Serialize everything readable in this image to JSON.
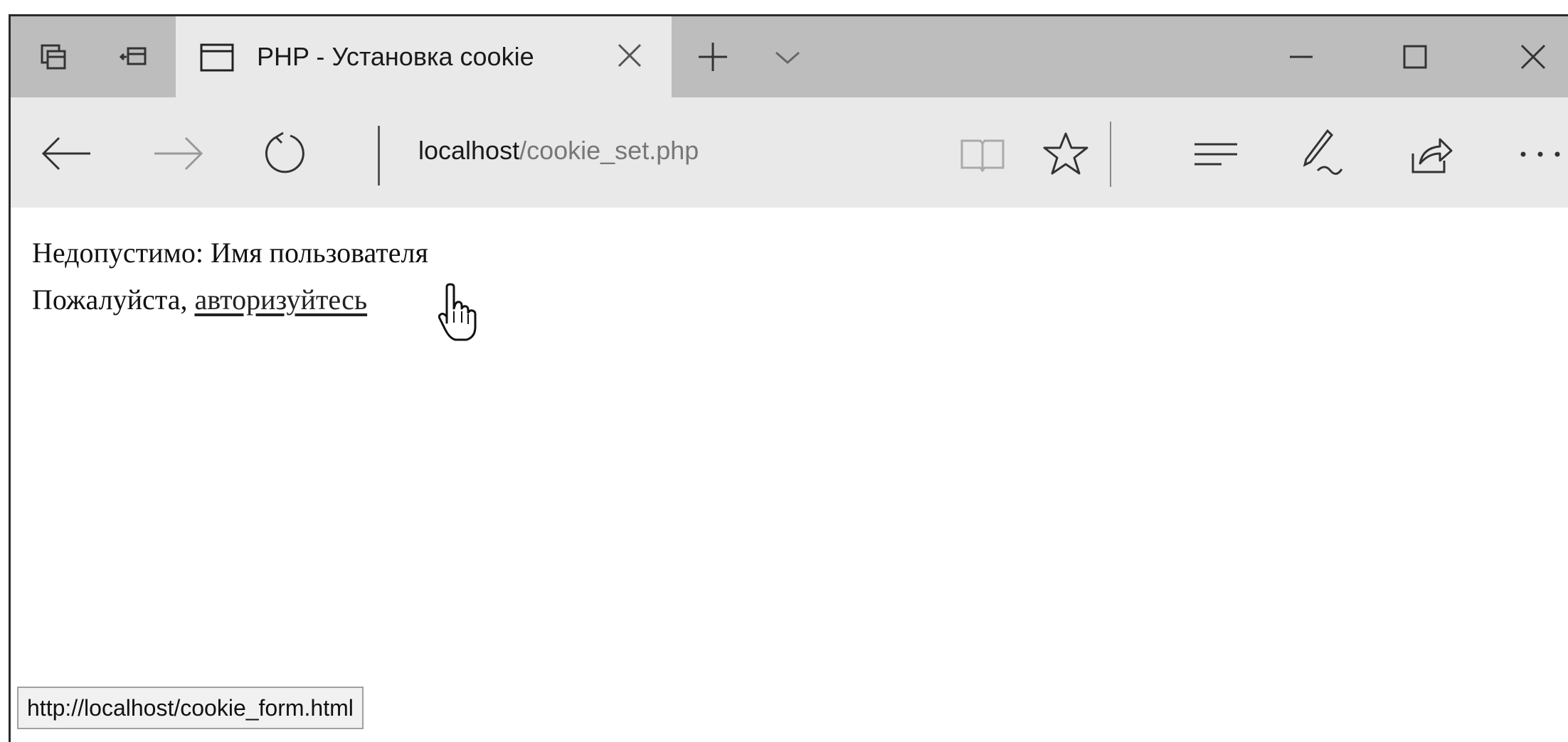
{
  "window": {
    "tab": {
      "title": "PHP - Установка cookie"
    },
    "controls": {
      "minimize_icon": "minimize-icon",
      "maximize_icon": "maximize-icon",
      "close_icon": "close-icon"
    }
  },
  "toolbar": {
    "address": {
      "host": "localhost",
      "path": "/cookie_set.php"
    }
  },
  "content": {
    "line1": "Недопустимо: Имя пользователя",
    "line2_prefix": "Пожалуйста, ",
    "link_text": "авторизуйтесь"
  },
  "status_bar": {
    "url": "http://localhost/cookie_form.html"
  },
  "colors": {
    "tabbar": "#bdbdbd",
    "toolbar": "#e9e9e9",
    "text": "#111111"
  }
}
